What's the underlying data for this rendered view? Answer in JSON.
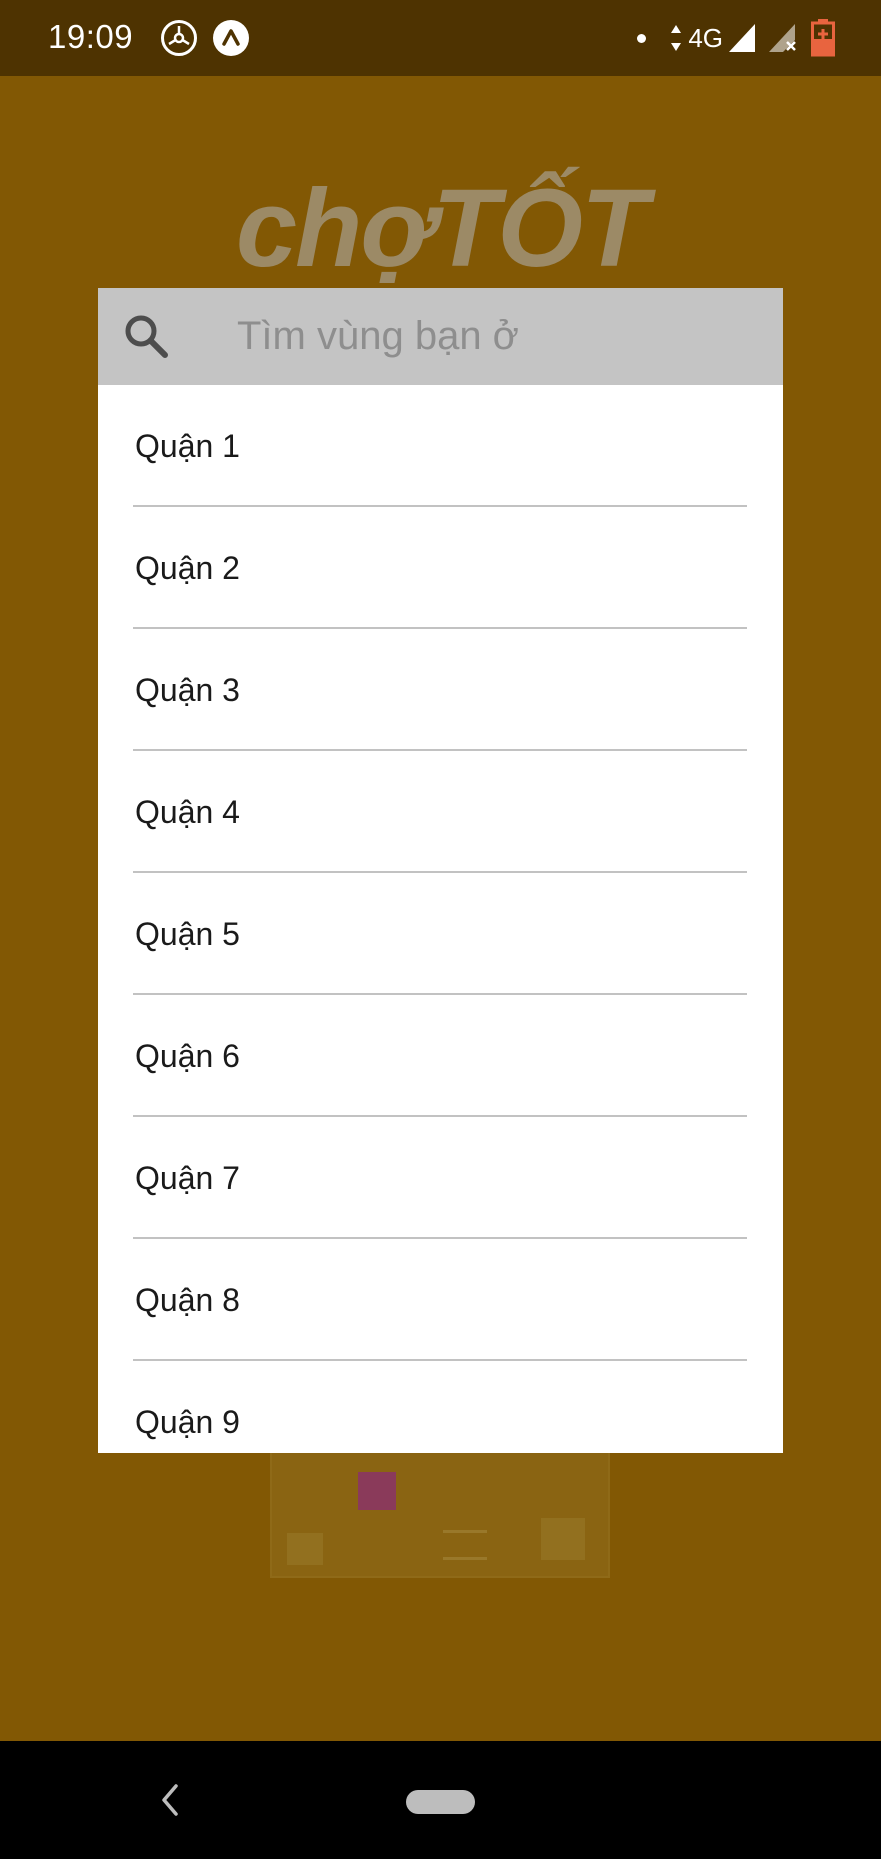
{
  "status_bar": {
    "time": "19:09",
    "network": "4G",
    "icons": [
      "gear-icon",
      "expo-icon",
      "data-arrows-icon",
      "signal-icon",
      "signal-no-sim-icon",
      "battery-charging-icon"
    ]
  },
  "background": {
    "logo_text": "chợTỐT"
  },
  "search": {
    "placeholder": "Tìm vùng bạn ở",
    "value": "",
    "icon": "search-icon"
  },
  "districts": [
    {
      "label": "Quận 1"
    },
    {
      "label": "Quận 2"
    },
    {
      "label": "Quận 3"
    },
    {
      "label": "Quận 4"
    },
    {
      "label": "Quận 5"
    },
    {
      "label": "Quận 6"
    },
    {
      "label": "Quận 7"
    },
    {
      "label": "Quận 8"
    },
    {
      "label": "Quận 9"
    }
  ],
  "nav": {
    "back_icon": "back-icon",
    "home_icon": "home-pill"
  },
  "colors": {
    "status_bar": "#4e3301",
    "overlay": "#825804",
    "search_bar": "#c4c4c4",
    "divider": "#c2c2c2",
    "battery": "#e8643f"
  }
}
